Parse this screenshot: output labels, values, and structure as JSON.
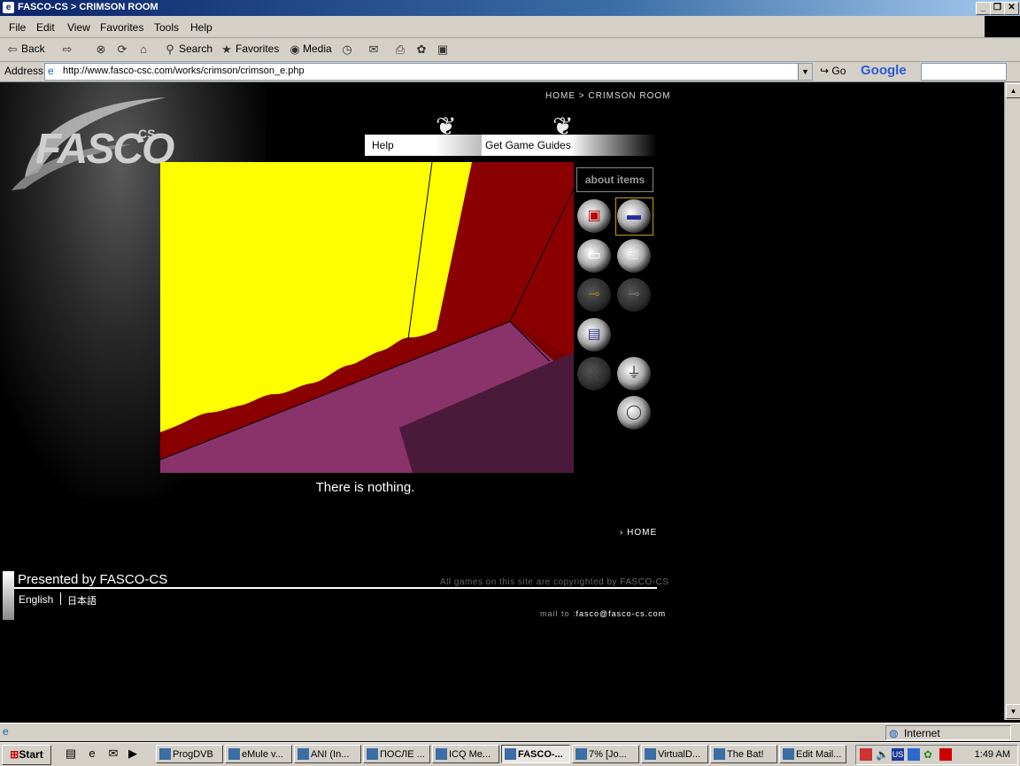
{
  "window": {
    "title": "FASCO-CS > CRIMSON ROOM",
    "controls": [
      "_",
      "❐",
      "✕"
    ]
  },
  "menu": [
    "File",
    "Edit",
    "View",
    "Favorites",
    "Tools",
    "Help"
  ],
  "toolbar": {
    "back": "Back",
    "search": "Search",
    "favorites": "Favorites",
    "media": "Media"
  },
  "address": {
    "label": "Address",
    "url": "http://www.fasco-csc.com/works/crimson/crimson_e.php",
    "go": "Go",
    "google": "Google"
  },
  "page": {
    "logo": "FASCO",
    "logo_suffix": "CS",
    "breadcrumb": "HOME > CRIMSON ROOM",
    "tab_help": "Help",
    "tab_guides": "Get Game Guides",
    "about_items": "about items",
    "message": "There is nothing.",
    "home_link": "HOME",
    "presented": "Presented by FASCO-CS",
    "copyright": "All games on this site are copyrighted by FASCO-CS",
    "lang_en": "English",
    "lang_jp": "日本語",
    "mail_label": "mail to :",
    "mail_addr": "fasco@fasco-cs.com"
  },
  "items": [
    {
      "name": "box-item",
      "icon": "▣",
      "color": "#b00"
    },
    {
      "name": "stick-item",
      "icon": "▬",
      "color": "#2a2a9a"
    },
    {
      "name": "paper-item",
      "icon": "▭",
      "color": "#fff"
    },
    {
      "name": "memo-item",
      "icon": "≣",
      "color": "#ddd"
    },
    {
      "name": "gold-key-item",
      "icon": "⊸",
      "color": "#a08020"
    },
    {
      "name": "silver-key-item",
      "icon": "⊸",
      "color": "#777"
    },
    {
      "name": "cd-case-item",
      "icon": "▤",
      "color": "#3a3a8a"
    },
    {
      "name": "stripes-item",
      "icon": "╳",
      "color": "#444"
    },
    {
      "name": "plug-item",
      "icon": "⏚",
      "color": "#222"
    },
    {
      "name": "ring-item",
      "icon": "◯",
      "color": "#333"
    }
  ],
  "status": {
    "zone": "Internet"
  },
  "taskbar": {
    "start": "Start",
    "tasks": [
      "ProgDVB",
      "eMule v...",
      "ANI (In...",
      "ПОСЛЕ ...",
      "ICQ Me...",
      "FASCO-...",
      "7% [Jo...",
      "VirtualD...",
      "The Bat!",
      "Edit Mail..."
    ],
    "clock": "1:49 AM",
    "lang": "US"
  }
}
